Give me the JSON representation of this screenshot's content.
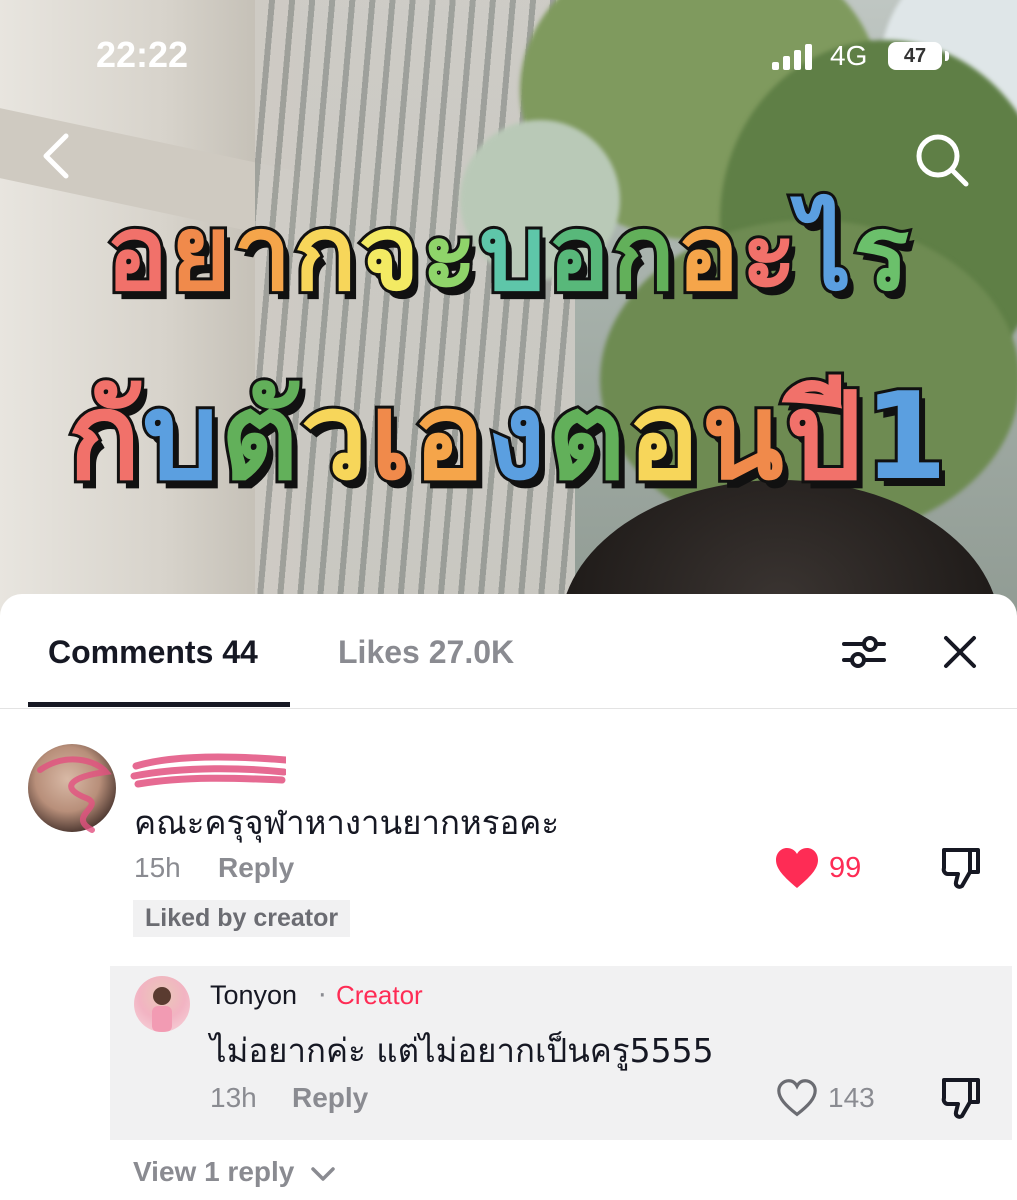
{
  "status_bar": {
    "time": "22:22",
    "network": "4G",
    "battery": "47"
  },
  "video": {
    "overlay_line1_chars": [
      {
        "ch": "อ",
        "color": "#f1716a"
      },
      {
        "ch": "ย",
        "color": "#f08a4b"
      },
      {
        "ch": "า",
        "color": "#f5a54a"
      },
      {
        "ch": "ก",
        "color": "#f7d65a"
      },
      {
        "ch": "จ",
        "color": "#f3ea63"
      },
      {
        "ch": "ะ",
        "color": "#8fd46a"
      },
      {
        "ch": "บ",
        "color": "#5ec6a9"
      },
      {
        "ch": "อ",
        "color": "#58b87a"
      },
      {
        "ch": "ก",
        "color": "#62b05a"
      },
      {
        "ch": "อ",
        "color": "#f5a54a"
      },
      {
        "ch": "ะ",
        "color": "#f1716a"
      },
      {
        "ch": "ไ",
        "color": "#5b9fe0"
      },
      {
        "ch": "ร",
        "color": "#6bc06b"
      }
    ],
    "overlay_line2_chars": [
      {
        "ch": "กั",
        "color": "#f1716a"
      },
      {
        "ch": "บ",
        "color": "#5b9fe0"
      },
      {
        "ch": "ตั",
        "color": "#62b05a"
      },
      {
        "ch": "ว",
        "color": "#f7d65a"
      },
      {
        "ch": "เ",
        "color": "#f08a4b"
      },
      {
        "ch": "อ",
        "color": "#f5a54a"
      },
      {
        "ch": "ง",
        "color": "#5b9fe0"
      },
      {
        "ch": "ต",
        "color": "#62b05a"
      },
      {
        "ch": "อ",
        "color": "#f7d65a"
      },
      {
        "ch": "น",
        "color": "#f08a4b"
      },
      {
        "ch": "ปี",
        "color": "#f1716a"
      },
      {
        "ch": "1",
        "color": "#5b9fe0"
      }
    ]
  },
  "tabs": {
    "comments_label": "Comments 44",
    "likes_label": "Likes 27.0K"
  },
  "comment": {
    "text": "คณะครุจุฬาหางานยากหรอคะ",
    "time": "15h",
    "reply_label": "Reply",
    "likes": "99",
    "liked": true,
    "badge": "Liked by creator"
  },
  "reply": {
    "username": "Tonyon",
    "separator": "·",
    "tag": "Creator",
    "text": "ไม่อยากค่ะ แต่ไม่อยากเป็นครู5555",
    "time": "13h",
    "reply_label": "Reply",
    "likes": "143"
  },
  "view_replies_label": "View 1 reply",
  "colors": {
    "accent": "#fe2c55",
    "text_primary": "#161823",
    "text_secondary": "#8a8b91",
    "reply_bg": "#f1f1f2"
  }
}
